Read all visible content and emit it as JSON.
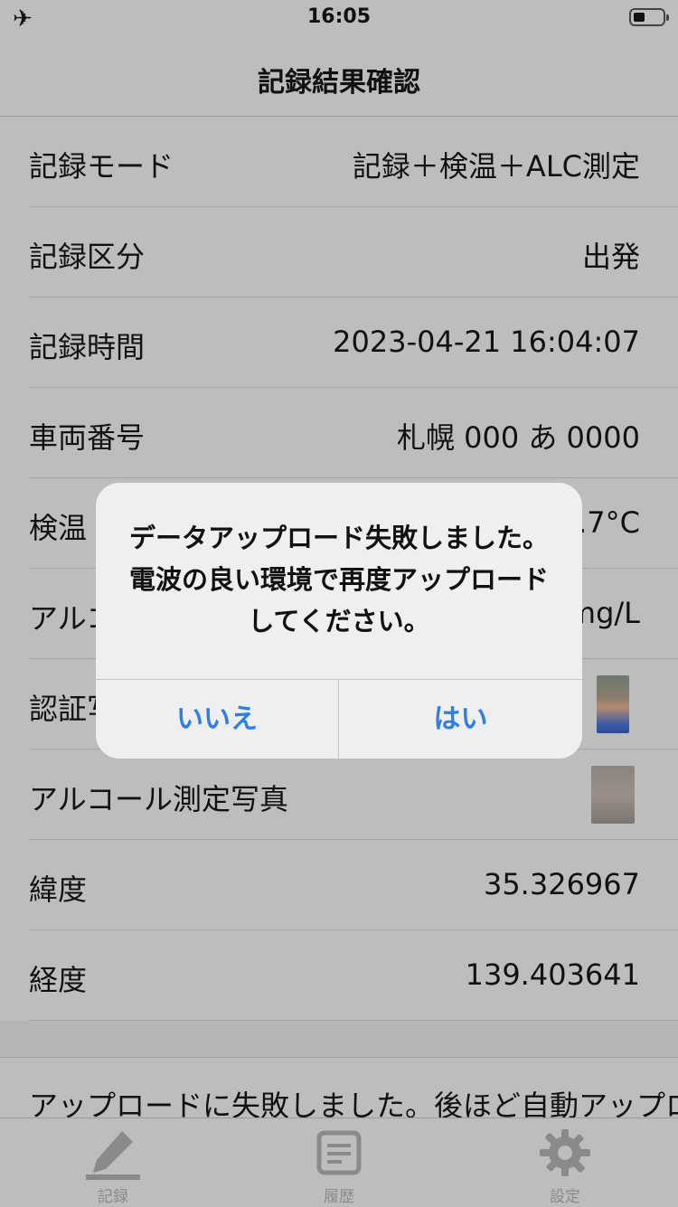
{
  "status_bar": {
    "time": "16:05",
    "airplane_icon": "airplane-icon",
    "battery_icon": "battery-icon"
  },
  "nav": {
    "title": "記録結果確認"
  },
  "rows": [
    {
      "label": "記録モード",
      "value": "記録＋検温＋ALC測定"
    },
    {
      "label": "記録区分",
      "value": "出発"
    },
    {
      "label": "記録時間",
      "value": "2023-04-21 16:04:07"
    },
    {
      "label": "車両番号",
      "value": "札幌 000 あ 0000"
    },
    {
      "label": "検温",
      "value": "36.7°C"
    },
    {
      "label": "アルコール",
      "value": "0.00mg/L"
    },
    {
      "label": "認証写真",
      "value": ""
    },
    {
      "label": "アルコール測定写真",
      "value": ""
    },
    {
      "label": "緯度",
      "value": "35.326967"
    },
    {
      "label": "経度",
      "value": "139.403641"
    }
  ],
  "notice": "アップロードに失敗しました。後ほど自動アップロードします。",
  "tabs": [
    {
      "label": "記録",
      "icon": "pencil-icon"
    },
    {
      "label": "履歴",
      "icon": "document-icon"
    },
    {
      "label": "設定",
      "icon": "gear-icon"
    }
  ],
  "dialog": {
    "message": "データアップロード失敗しました。電波の良い環境で再度アップロードしてください。",
    "no_label": "いいえ",
    "yes_label": "はい",
    "accent": "#2d7fe6"
  }
}
